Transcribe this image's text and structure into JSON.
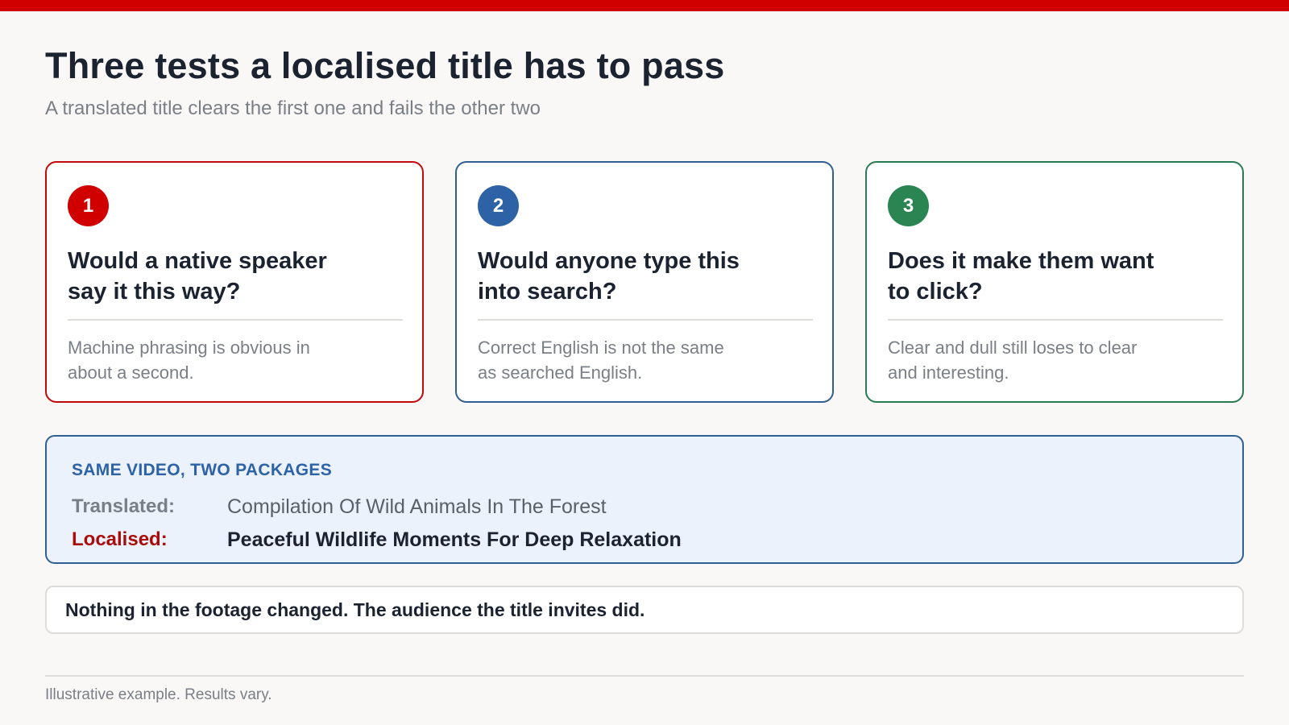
{
  "header": {
    "title": "Three tests a localised title has to pass",
    "subtitle": "A translated title clears the first one and fails the other two"
  },
  "cards": [
    {
      "number": "1",
      "heading": "Would a native speaker say it this way?",
      "body": "Machine phrasing is obvious in about a second.",
      "color": "#c20a0a"
    },
    {
      "number": "2",
      "heading": "Would anyone type this into search?",
      "body": "Correct English is not the same as searched English.",
      "color": "#2f5f93"
    },
    {
      "number": "3",
      "heading": "Does it make them want to click?",
      "body": "Clear and dull still loses to clear and interesting.",
      "color": "#2a7a52"
    }
  ],
  "comparison": {
    "label": "SAME VIDEO, TWO PACKAGES",
    "translated_key": "Translated:",
    "translated_value": "Compilation Of Wild Animals In The Forest",
    "localised_key": "Localised:",
    "localised_value": "Peaceful Wildlife Moments For Deep Relaxation"
  },
  "takeaway": "Nothing in the footage changed. The audience the title invites did.",
  "footnote": "Illustrative example. Results vary.",
  "colors": {
    "accent": "#d10000",
    "blue": "#2d62a6",
    "green": "#2a8553"
  }
}
